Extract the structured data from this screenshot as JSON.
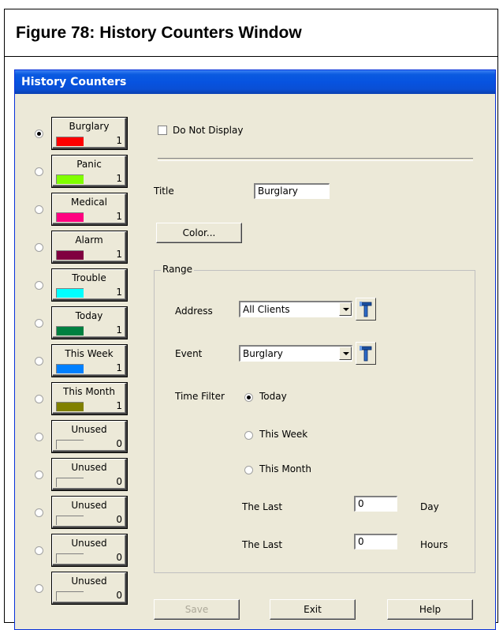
{
  "figure": {
    "title": "Figure 78:  History Counters Window"
  },
  "window": {
    "title": "History Counters"
  },
  "counters": [
    {
      "label": "Burglary",
      "count": "1",
      "color": "#ff0000",
      "selected": true
    },
    {
      "label": "Panic",
      "count": "1",
      "color": "#80ff00",
      "selected": false
    },
    {
      "label": "Medical",
      "count": "1",
      "color": "#ff0080",
      "selected": false
    },
    {
      "label": "Alarm",
      "count": "1",
      "color": "#800040",
      "selected": false
    },
    {
      "label": "Trouble",
      "count": "1",
      "color": "#00ffff",
      "selected": false
    },
    {
      "label": "Today",
      "count": "1",
      "color": "#008040",
      "selected": false
    },
    {
      "label": "This Week",
      "count": "1",
      "color": "#0080ff",
      "selected": false
    },
    {
      "label": "This Month",
      "count": "1",
      "color": "#808000",
      "selected": false
    },
    {
      "label": "Unused",
      "count": "0",
      "color": "#ece9d8",
      "selected": false
    },
    {
      "label": "Unused",
      "count": "0",
      "color": "#ece9d8",
      "selected": false
    },
    {
      "label": "Unused",
      "count": "0",
      "color": "#ece9d8",
      "selected": false
    },
    {
      "label": "Unused",
      "count": "0",
      "color": "#ece9d8",
      "selected": false
    },
    {
      "label": "Unused",
      "count": "0",
      "color": "#ece9d8",
      "selected": false
    }
  ],
  "form": {
    "do_not_display_label": "Do Not Display",
    "title_label": "Title",
    "title_value": "Burglary",
    "color_button": "Color...",
    "range_label": "Range",
    "address_label": "Address",
    "address_value": "All Clients",
    "event_label": "Event",
    "event_value": "Burglary",
    "time_filter_label": "Time Filter",
    "time_options": [
      "Today",
      "This Week",
      "This Month"
    ],
    "time_selected": "Today",
    "last_label_1": "The Last",
    "last_value_1": "0",
    "last_unit_1": "Day",
    "last_label_2": "The Last",
    "last_value_2": "0",
    "last_unit_2": "Hours"
  },
  "buttons": {
    "save": "Save",
    "exit": "Exit",
    "help": "Help"
  }
}
